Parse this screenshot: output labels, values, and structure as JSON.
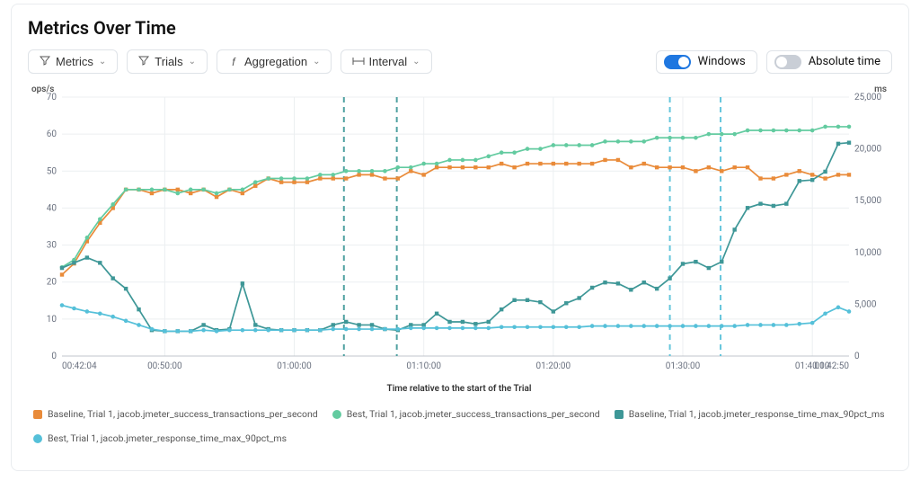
{
  "header": {
    "title": "Metrics Over Time"
  },
  "toolbar": {
    "metrics": "Metrics",
    "trials": "Trials",
    "aggregation": "Aggregation",
    "interval": "Interval",
    "windows": "Windows",
    "absolute_time": "Absolute time"
  },
  "colors": {
    "orange": "#e98b3a",
    "green": "#63cba0",
    "teal": "#3e9797",
    "cyan": "#55c0d9",
    "grid": "#eceff1",
    "axis": "#6b7280",
    "vline_teal": "#3e9797",
    "vline_cyan": "#55c0d9"
  },
  "chart_data": {
    "type": "line",
    "title": "Metrics Over Time",
    "xlabel": "Time relative to the start of the Trial",
    "y_left_label": "ops/s",
    "y_right_label": "ms",
    "ylim_left": [
      0,
      70
    ],
    "ylim_right": [
      0,
      25000
    ],
    "x_tick_labels": [
      "00:42:04",
      "00:50:00",
      "01:00:00",
      "01:10:00",
      "01:20:00",
      "01:30:00",
      "01:40:00",
      "01:42:50"
    ],
    "x_tick_sec": [
      2524,
      3000,
      3600,
      4200,
      4800,
      5400,
      6000,
      6170
    ],
    "vertical_markers": [
      {
        "sec": 3830,
        "color_key": "vline_teal"
      },
      {
        "sec": 4075,
        "color_key": "vline_teal"
      },
      {
        "sec": 5340,
        "color_key": "vline_cyan"
      },
      {
        "sec": 5575,
        "color_key": "vline_cyan"
      }
    ],
    "series": [
      {
        "name": "Baseline, Trial 1, jacob.jmeter_success_transactions_per_second",
        "axis": "left",
        "color_key": "orange",
        "marker": "square",
        "x_sec": [
          2524,
          2580,
          2640,
          2700,
          2760,
          2820,
          2880,
          2940,
          3000,
          3060,
          3120,
          3180,
          3240,
          3300,
          3360,
          3420,
          3480,
          3540,
          3600,
          3660,
          3720,
          3780,
          3840,
          3900,
          3960,
          4020,
          4080,
          4140,
          4200,
          4260,
          4320,
          4380,
          4440,
          4500,
          4560,
          4620,
          4680,
          4740,
          4800,
          4860,
          4920,
          4980,
          5040,
          5100,
          5160,
          5220,
          5280,
          5340,
          5400,
          5460,
          5520,
          5580,
          5640,
          5700,
          5760,
          5820,
          5880,
          5940,
          6000,
          6060,
          6120,
          6170
        ],
        "y": [
          22,
          25,
          31,
          36,
          40,
          45,
          45,
          44,
          45,
          45,
          44,
          45,
          43,
          45,
          44,
          46,
          48,
          47,
          47,
          47,
          48,
          48,
          48,
          49,
          49,
          48,
          48,
          50,
          49,
          51,
          51,
          51,
          51,
          51,
          52,
          51,
          52,
          52,
          52,
          52,
          52,
          52,
          53,
          53,
          51,
          52,
          51,
          51,
          51,
          50,
          51,
          50,
          51,
          51,
          48,
          48,
          49,
          50,
          49,
          48,
          49,
          49
        ]
      },
      {
        "name": "Best, Trial 1, jacob.jmeter_success_transactions_per_second",
        "axis": "left",
        "color_key": "green",
        "marker": "circle",
        "x_sec": [
          2524,
          2580,
          2640,
          2700,
          2760,
          2820,
          2880,
          2940,
          3000,
          3060,
          3120,
          3180,
          3240,
          3300,
          3360,
          3420,
          3480,
          3540,
          3600,
          3660,
          3720,
          3780,
          3840,
          3900,
          3960,
          4020,
          4080,
          4140,
          4200,
          4260,
          4320,
          4380,
          4440,
          4500,
          4560,
          4620,
          4680,
          4740,
          4800,
          4860,
          4920,
          4980,
          5040,
          5100,
          5160,
          5220,
          5280,
          5340,
          5400,
          5460,
          5520,
          5580,
          5640,
          5700,
          5760,
          5820,
          5880,
          5940,
          6000,
          6060,
          6120,
          6170
        ],
        "y": [
          24,
          26,
          32,
          37,
          41,
          45,
          45,
          45,
          45,
          44,
          45,
          45,
          44,
          45,
          45,
          47,
          48,
          48,
          48,
          48,
          49,
          49,
          50,
          50,
          50,
          50,
          51,
          51,
          52,
          52,
          53,
          53,
          53,
          54,
          55,
          55,
          56,
          56,
          57,
          57,
          57,
          57,
          58,
          58,
          58,
          58,
          59,
          59,
          59,
          59,
          60,
          60,
          60,
          61,
          61,
          61,
          61,
          61,
          61,
          62,
          62,
          62
        ]
      },
      {
        "name": "Baseline, Trial 1, jacob.jmeter_response_time_max_90pct_ms",
        "axis": "right",
        "color_key": "teal",
        "marker": "square",
        "x_sec": [
          2524,
          2580,
          2640,
          2700,
          2760,
          2820,
          2880,
          2940,
          3000,
          3060,
          3120,
          3180,
          3240,
          3300,
          3360,
          3420,
          3480,
          3540,
          3600,
          3660,
          3720,
          3780,
          3840,
          3900,
          3960,
          4020,
          4080,
          4140,
          4200,
          4260,
          4320,
          4380,
          4440,
          4500,
          4560,
          4620,
          4680,
          4740,
          4800,
          4860,
          4920,
          4980,
          5040,
          5100,
          5160,
          5220,
          5280,
          5340,
          5400,
          5460,
          5520,
          5580,
          5640,
          5700,
          5760,
          5820,
          5880,
          5940,
          6000,
          6060,
          6120,
          6170
        ],
        "y": [
          8500,
          9000,
          9500,
          9000,
          7500,
          6500,
          4500,
          2500,
          2400,
          2400,
          2400,
          3000,
          2500,
          2600,
          7000,
          3000,
          2600,
          2500,
          2500,
          2500,
          2500,
          3000,
          3300,
          3000,
          3000,
          2600,
          2500,
          3000,
          3000,
          4100,
          3300,
          3300,
          3100,
          3300,
          4500,
          5400,
          5400,
          5200,
          4300,
          5100,
          5600,
          6600,
          7100,
          7000,
          6400,
          7100,
          6500,
          7500,
          8900,
          9100,
          8500,
          9100,
          12200,
          14300,
          14700,
          14500,
          14700,
          16900,
          17000,
          17800,
          20500,
          20600
        ]
      },
      {
        "name": "Best, Trial 1, jacob.jmeter_response_time_max_90pct_ms",
        "axis": "right",
        "color_key": "cyan",
        "marker": "circle",
        "x_sec": [
          2524,
          2580,
          2640,
          2700,
          2760,
          2820,
          2880,
          2940,
          3000,
          3060,
          3120,
          3180,
          3240,
          3300,
          3360,
          3420,
          3480,
          3540,
          3600,
          3660,
          3720,
          3780,
          3840,
          3900,
          3960,
          4020,
          4080,
          4140,
          4200,
          4260,
          4320,
          4380,
          4440,
          4500,
          4560,
          4620,
          4680,
          4740,
          4800,
          4860,
          4920,
          4980,
          5040,
          5100,
          5160,
          5220,
          5280,
          5340,
          5400,
          5460,
          5520,
          5580,
          5640,
          5700,
          5760,
          5820,
          5880,
          5940,
          6000,
          6060,
          6120,
          6170
        ],
        "y": [
          4900,
          4600,
          4300,
          4100,
          3800,
          3400,
          3000,
          2600,
          2400,
          2400,
          2400,
          2500,
          2400,
          2500,
          2500,
          2500,
          2500,
          2500,
          2500,
          2500,
          2500,
          2600,
          2600,
          2600,
          2600,
          2600,
          2600,
          2700,
          2700,
          2700,
          2700,
          2700,
          2700,
          2700,
          2800,
          2800,
          2800,
          2800,
          2800,
          2800,
          2800,
          2900,
          2900,
          2900,
          2900,
          2900,
          2900,
          2900,
          2900,
          2900,
          2900,
          2900,
          2900,
          3000,
          3000,
          3000,
          3000,
          3100,
          3200,
          4100,
          4700,
          4300
        ]
      }
    ],
    "legend": [
      {
        "label": "Baseline, Trial 1, jacob.jmeter_success_transactions_per_second",
        "color_key": "orange",
        "shape": "sq"
      },
      {
        "label": "Best, Trial 1, jacob.jmeter_success_transactions_per_second",
        "color_key": "green",
        "shape": "ci"
      },
      {
        "label": "Baseline, Trial 1, jacob.jmeter_response_time_max_90pct_ms",
        "color_key": "teal",
        "shape": "sq"
      },
      {
        "label": "Best, Trial 1, jacob.jmeter_response_time_max_90pct_ms",
        "color_key": "cyan",
        "shape": "ci"
      }
    ]
  }
}
